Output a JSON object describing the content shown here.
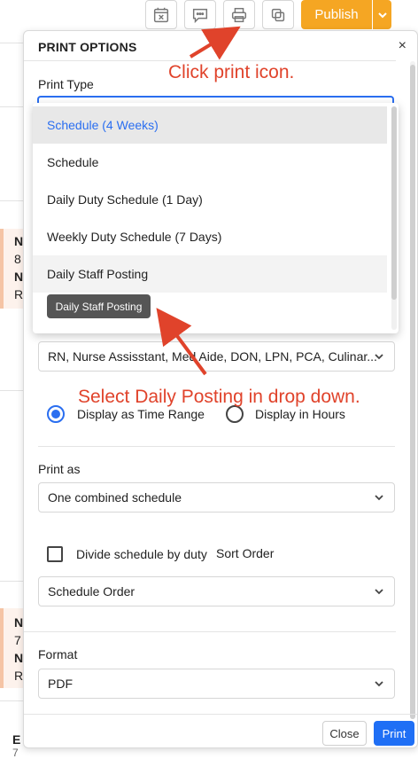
{
  "toolbar": {
    "publish_label": "Publish",
    "icons": [
      "calendar-x-icon",
      "comment-icon",
      "printer-icon",
      "copy-icon"
    ]
  },
  "background_cards": [
    {
      "line1": "N",
      "line2": "8",
      "line3": "N",
      "line4": "R"
    },
    {
      "line1": "N",
      "line2": "7",
      "line3": "N",
      "line4": "R"
    }
  ],
  "background_bottom": {
    "line1": "E",
    "line2": "7"
  },
  "dialog": {
    "title": "PRINT OPTIONS",
    "close_glyph": "×",
    "print_type_label": "Print Type",
    "print_type_options": [
      "Schedule (4 Weeks)",
      "Schedule",
      "Daily Duty Schedule (1 Day)",
      "Weekly Duty Schedule (7 Days)",
      "Daily Staff Posting"
    ],
    "tooltip": "Daily Staff Posting",
    "labels_select_value": "RN, Nurse Assisstant, Med Aide, DON, LPN, PCA, Culinar...",
    "radio_time_range": "Display as Time Range",
    "radio_hours": "Display in Hours",
    "print_as_label": "Print as",
    "print_as_value": "One combined schedule",
    "divide_label": "Divide schedule by duty",
    "sort_order_label": "Sort Order",
    "sort_order_value": "Schedule Order",
    "format_label": "Format",
    "format_value": "PDF",
    "close_button": "Close",
    "print_button": "Print"
  },
  "annotations": {
    "click_print": "Click print icon.",
    "select_daily": "Select Daily Posting in drop down."
  },
  "colors": {
    "accent": "#2a6ef0",
    "publish": "#f5a623",
    "annotation": "#e0432b"
  }
}
